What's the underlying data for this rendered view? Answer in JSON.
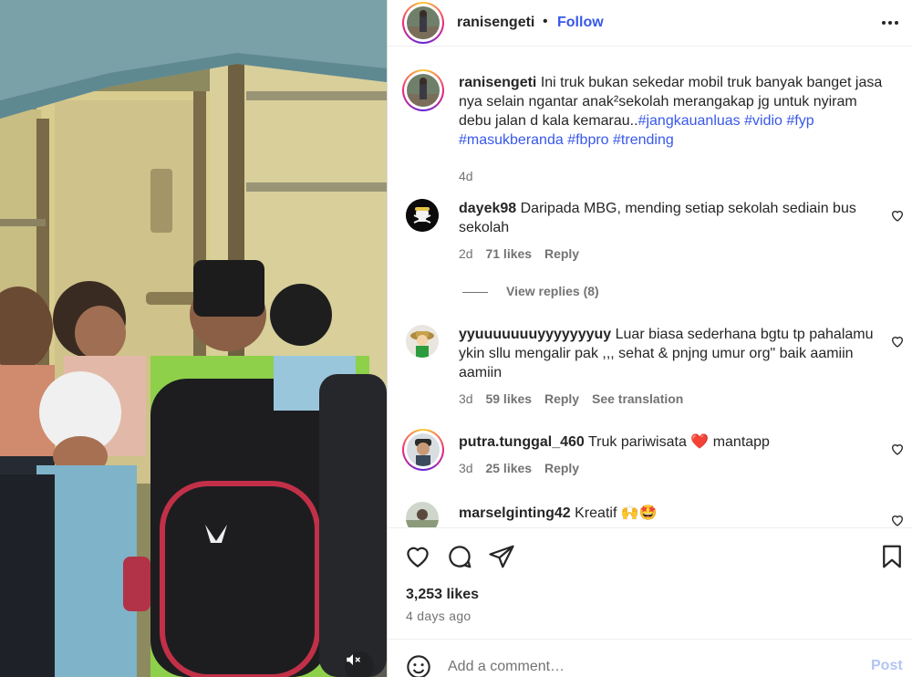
{
  "post": {
    "author": "ranisengeti",
    "separator": "•",
    "follow_label": "Follow",
    "more_icon": "more-horizontal-icon",
    "caption_text": "Ini truk bukan sekedar mobil truk banyak banget jasa nya selain ngantar anak²sekolah merangakap jg untuk nyiram debu jalan d kala kemarau..",
    "hashtags": [
      "#jangkauanluas",
      "#vidio",
      "#fyp",
      "#masukberanda",
      "#fbpro",
      "#trending"
    ],
    "caption_age": "4d"
  },
  "comments": [
    {
      "user": "dayek98",
      "text": "Daripada MBG, mending setiap sekolah sediain bus sekolah",
      "age": "2d",
      "likes": "71 likes",
      "reply": "Reply",
      "view_replies": "View replies (8)"
    },
    {
      "user": "yyuuuuuuuyyyyyyyuy",
      "text": "Luar biasa sederhana bgtu tp pahalamu ykin sllu mengalir pak ,,, sehat & pnjng umur org\" baik aamiin aamiin",
      "age": "3d",
      "likes": "59 likes",
      "reply": "Reply",
      "translate": "See translation"
    },
    {
      "user": "putra.tunggal_460",
      "text_before": "Truk pariwisata",
      "emoji": "❤️",
      "text_after": "mantapp",
      "age": "3d",
      "likes": "25 likes",
      "reply": "Reply"
    },
    {
      "user": "marselginting42",
      "text": "Kreatif",
      "emoji": "🙌🤩"
    }
  ],
  "actions": {
    "like_icon": "heart-icon",
    "comment_icon": "comment-icon",
    "share_icon": "share-icon",
    "save_icon": "bookmark-icon"
  },
  "likes_count": "3,253 likes",
  "posted_ago": "4 days ago",
  "add_comment": {
    "placeholder": "Add a comment…",
    "post_label": "Post",
    "emoji_icon": "emoji-icon"
  },
  "media": {
    "mute_icon": "speaker-muted-icon"
  },
  "colors": {
    "link_blue": "#3858e9",
    "muted_text": "#737373",
    "post_disabled": "#b3c4f5",
    "divider": "#dbdbdb"
  }
}
